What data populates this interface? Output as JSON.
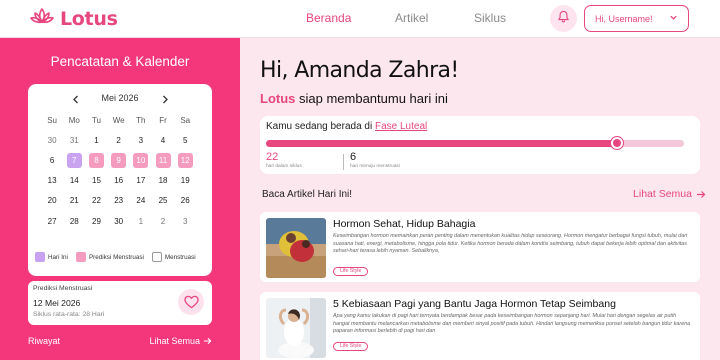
{
  "app": {
    "name": "Lotus"
  },
  "nav": {
    "items": [
      {
        "label": "Beranda",
        "active": true
      },
      {
        "label": "Artikel",
        "active": false
      },
      {
        "label": "Siklus",
        "active": false
      }
    ],
    "user_button": "Hi, Username!",
    "icons": {
      "notifications": "bell-icon",
      "dropdown": "chevron-down-icon",
      "logo": "lotus-icon"
    }
  },
  "sidebar": {
    "title": "Pencatatan & Kalender",
    "calendar": {
      "month_label": "Mei 2026",
      "weekdays": [
        "Su",
        "Mo",
        "Tu",
        "We",
        "Th",
        "Fr",
        "Sa"
      ],
      "weeks": [
        [
          {
            "d": "30",
            "s": "muted"
          },
          {
            "d": "31",
            "s": "muted"
          },
          {
            "d": "1",
            "s": ""
          },
          {
            "d": "2",
            "s": ""
          },
          {
            "d": "3",
            "s": ""
          },
          {
            "d": "4",
            "s": ""
          },
          {
            "d": "5",
            "s": ""
          }
        ],
        [
          {
            "d": "6",
            "s": ""
          },
          {
            "d": "7",
            "s": "today"
          },
          {
            "d": "8",
            "s": "predict"
          },
          {
            "d": "9",
            "s": "predict"
          },
          {
            "d": "10",
            "s": "predict"
          },
          {
            "d": "11",
            "s": "predict"
          },
          {
            "d": "12",
            "s": "predict"
          }
        ],
        [
          {
            "d": "13",
            "s": ""
          },
          {
            "d": "14",
            "s": ""
          },
          {
            "d": "15",
            "s": ""
          },
          {
            "d": "16",
            "s": ""
          },
          {
            "d": "17",
            "s": ""
          },
          {
            "d": "18",
            "s": ""
          },
          {
            "d": "19",
            "s": ""
          }
        ],
        [
          {
            "d": "20",
            "s": ""
          },
          {
            "d": "21",
            "s": ""
          },
          {
            "d": "22",
            "s": ""
          },
          {
            "d": "23",
            "s": ""
          },
          {
            "d": "24",
            "s": ""
          },
          {
            "d": "25",
            "s": ""
          },
          {
            "d": "26",
            "s": ""
          }
        ],
        [
          {
            "d": "27",
            "s": ""
          },
          {
            "d": "28",
            "s": ""
          },
          {
            "d": "29",
            "s": ""
          },
          {
            "d": "30",
            "s": ""
          },
          {
            "d": "1",
            "s": "muted"
          },
          {
            "d": "2",
            "s": "muted"
          },
          {
            "d": "3",
            "s": "muted"
          }
        ]
      ]
    },
    "legend": [
      {
        "label": "Hari Ini",
        "color": "#c9a3ef"
      },
      {
        "label": "Prediksi Menstruasi",
        "color": "#f59bbd"
      },
      {
        "label": "Menstruasi",
        "color": "#ffffff"
      }
    ],
    "prediction": {
      "label": "Prediksi Menstruasi",
      "date": "12 Mei 2026",
      "cycle": "Siklus rata-rata: 28 Hari"
    },
    "history": {
      "title": "Riwayat",
      "see_all": "Lihat Semua"
    }
  },
  "main": {
    "greeting": "Hi, Amanda Zahra!",
    "subtitle_brand": "Lotus",
    "subtitle_rest": " siap membantumu hari ini",
    "phase": {
      "prefix": "Kamu sedang berada di ",
      "name": "Fase Luteal",
      "progress": 0.84,
      "days_in_cycle": "22",
      "days_in_cycle_caption": "hari dalam siklus",
      "days_to_menstruation": "6",
      "days_to_menstruation_caption": "hari menuju menstruasi"
    },
    "articles_header": {
      "title": "Baca Artikel Hari Ini!",
      "see_all": "Lihat Semua"
    },
    "articles": [
      {
        "title": "Hormon Sehat, Hidup Bahagia",
        "body": "Keseimbangan hormon memainkan peran penting dalam menentukan kualitas hidup seseorang. Hormon mengatur berbagai fungsi tubuh, mulai dari suasana hati, energi, metabolisme, hingga pola tidur. Ketika hormon berada dalam kondisi seimbang, tubuh dapat bekerja lebih optimal dan aktivitas sehari-hari terasa lebih nyaman. Sebaliknya,",
        "tag": "Life Style"
      },
      {
        "title": "5 Kebiasaan Pagi yang Bantu Jaga Hormon Tetap Seimbang",
        "body": "Apa yang kamu lakukan di pagi hari ternyata berdampak besar pada keseimbangan hormon sepanjang hari. Mulai hari dengan segelas air putih hangat membantu melancarkan metabolisme dan memberi sinyal positif pada tubuh. Hindari langsung memeriksa ponsel setelah bangun tidur karena paparan informasi berlebih di pagi hari dan",
        "tag": "Life Style"
      }
    ]
  },
  "colors": {
    "brand": "#e7467e",
    "sidebar": "#f3377a",
    "background": "#fde7ef"
  }
}
